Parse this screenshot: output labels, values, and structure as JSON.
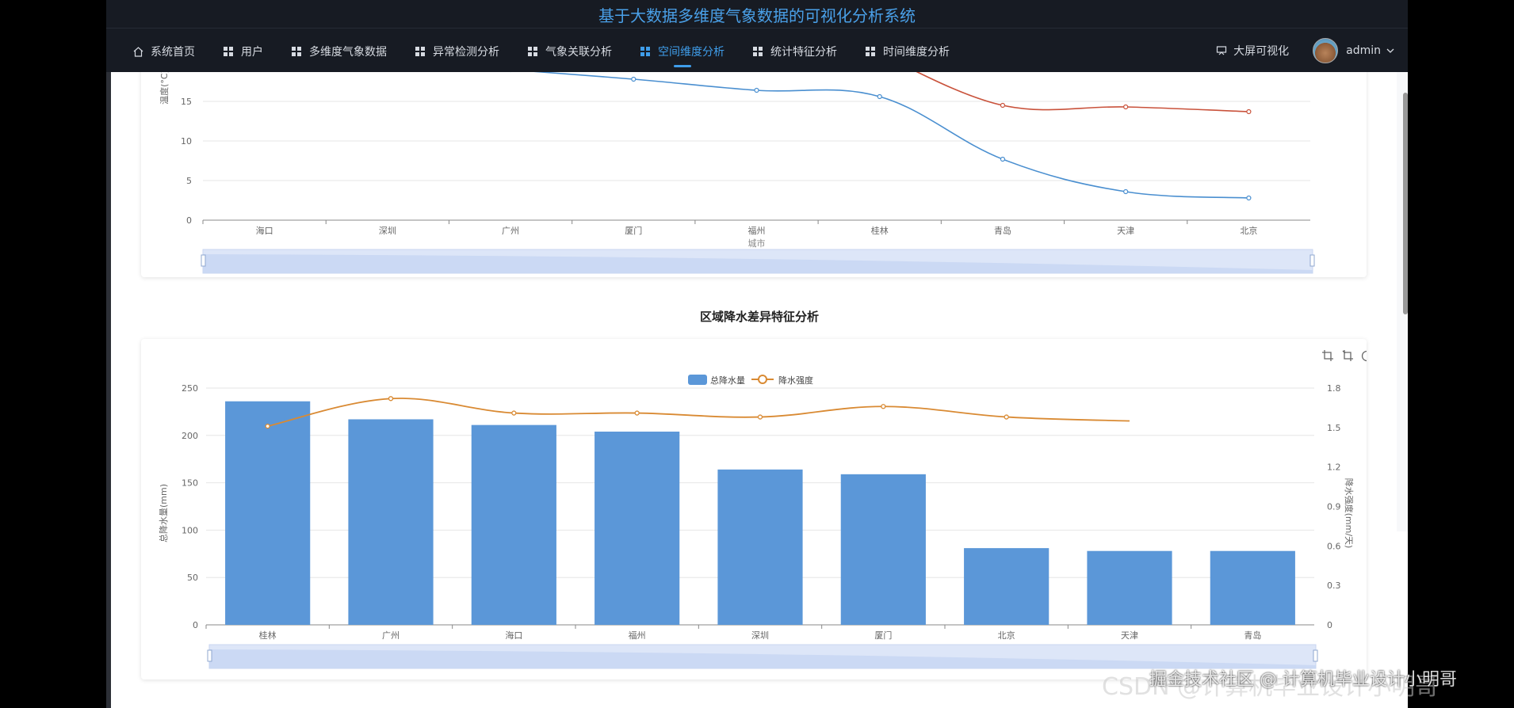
{
  "app": {
    "title": "基于大数据多维度气象数据的可视化分析系统"
  },
  "nav": {
    "items": [
      {
        "label": "系统首页"
      },
      {
        "label": "用户"
      },
      {
        "label": "多维度气象数据"
      },
      {
        "label": "异常检测分析"
      },
      {
        "label": "气象关联分析"
      },
      {
        "label": "空间维度分析"
      },
      {
        "label": "统计特征分析"
      },
      {
        "label": "时间维度分析"
      }
    ],
    "active_index": 5,
    "screen_label": "大屏可视化",
    "user_name": "admin"
  },
  "section2_title": "区域降水差异特征分析",
  "watermark": {
    "primary": "掘金技术社区 @ 计算机毕业设计小明哥",
    "secondary": "CSDN @计算机毕业设计小明哥"
  },
  "colors": {
    "accent": "#3f9dea",
    "bar": "#5b97d8",
    "line_orange": "#d98a33",
    "line_blue": "#4a8fd0",
    "line_red": "#c9523b"
  },
  "chart_data": [
    {
      "type": "line",
      "categories": [
        "海口",
        "深圳",
        "广州",
        "厦门",
        "福州",
        "桂林",
        "青岛",
        "天津",
        "北京"
      ],
      "ylabel": "温度(°C)",
      "xlabel": "城市",
      "yticks": [
        0,
        5,
        10,
        15
      ],
      "ylim": [
        0,
        20
      ],
      "series": [
        {
          "values": [
            null,
            null,
            19,
            17.8,
            16.4,
            15.6,
            7.7,
            3.6,
            2.8
          ]
        },
        {
          "values": [
            null,
            null,
            null,
            null,
            null,
            21,
            14.5,
            14.3,
            13.7
          ]
        }
      ],
      "datazoom": true
    },
    {
      "type": "bar",
      "categories": [
        "桂林",
        "广州",
        "海口",
        "福州",
        "深圳",
        "厦门",
        "北京",
        "天津",
        "青岛"
      ],
      "xlabel": "城市",
      "ylabel": "总降水量(mm)",
      "ylabel2": "降水强度(mm/天)",
      "ylim": [
        0,
        250
      ],
      "yticks": [
        0,
        50,
        100,
        150,
        200,
        250
      ],
      "ylim2": [
        0,
        1.8
      ],
      "yticks2": [
        0,
        0.3,
        0.6,
        0.9,
        1.2,
        1.5,
        1.8
      ],
      "legend": [
        "总降水量",
        "降水强度"
      ],
      "series": [
        {
          "name": "总降水量",
          "type": "bar",
          "values": [
            236,
            217,
            211,
            204,
            164,
            159,
            81,
            78,
            78
          ]
        },
        {
          "name": "降水强度",
          "type": "line",
          "values": [
            1.51,
            1.72,
            1.61,
            1.61,
            1.58,
            1.66,
            1.58,
            1.55,
            null
          ]
        }
      ],
      "datazoom": true,
      "toolbox": [
        "zoom",
        "zoom-reset",
        "restore",
        "save"
      ]
    }
  ]
}
